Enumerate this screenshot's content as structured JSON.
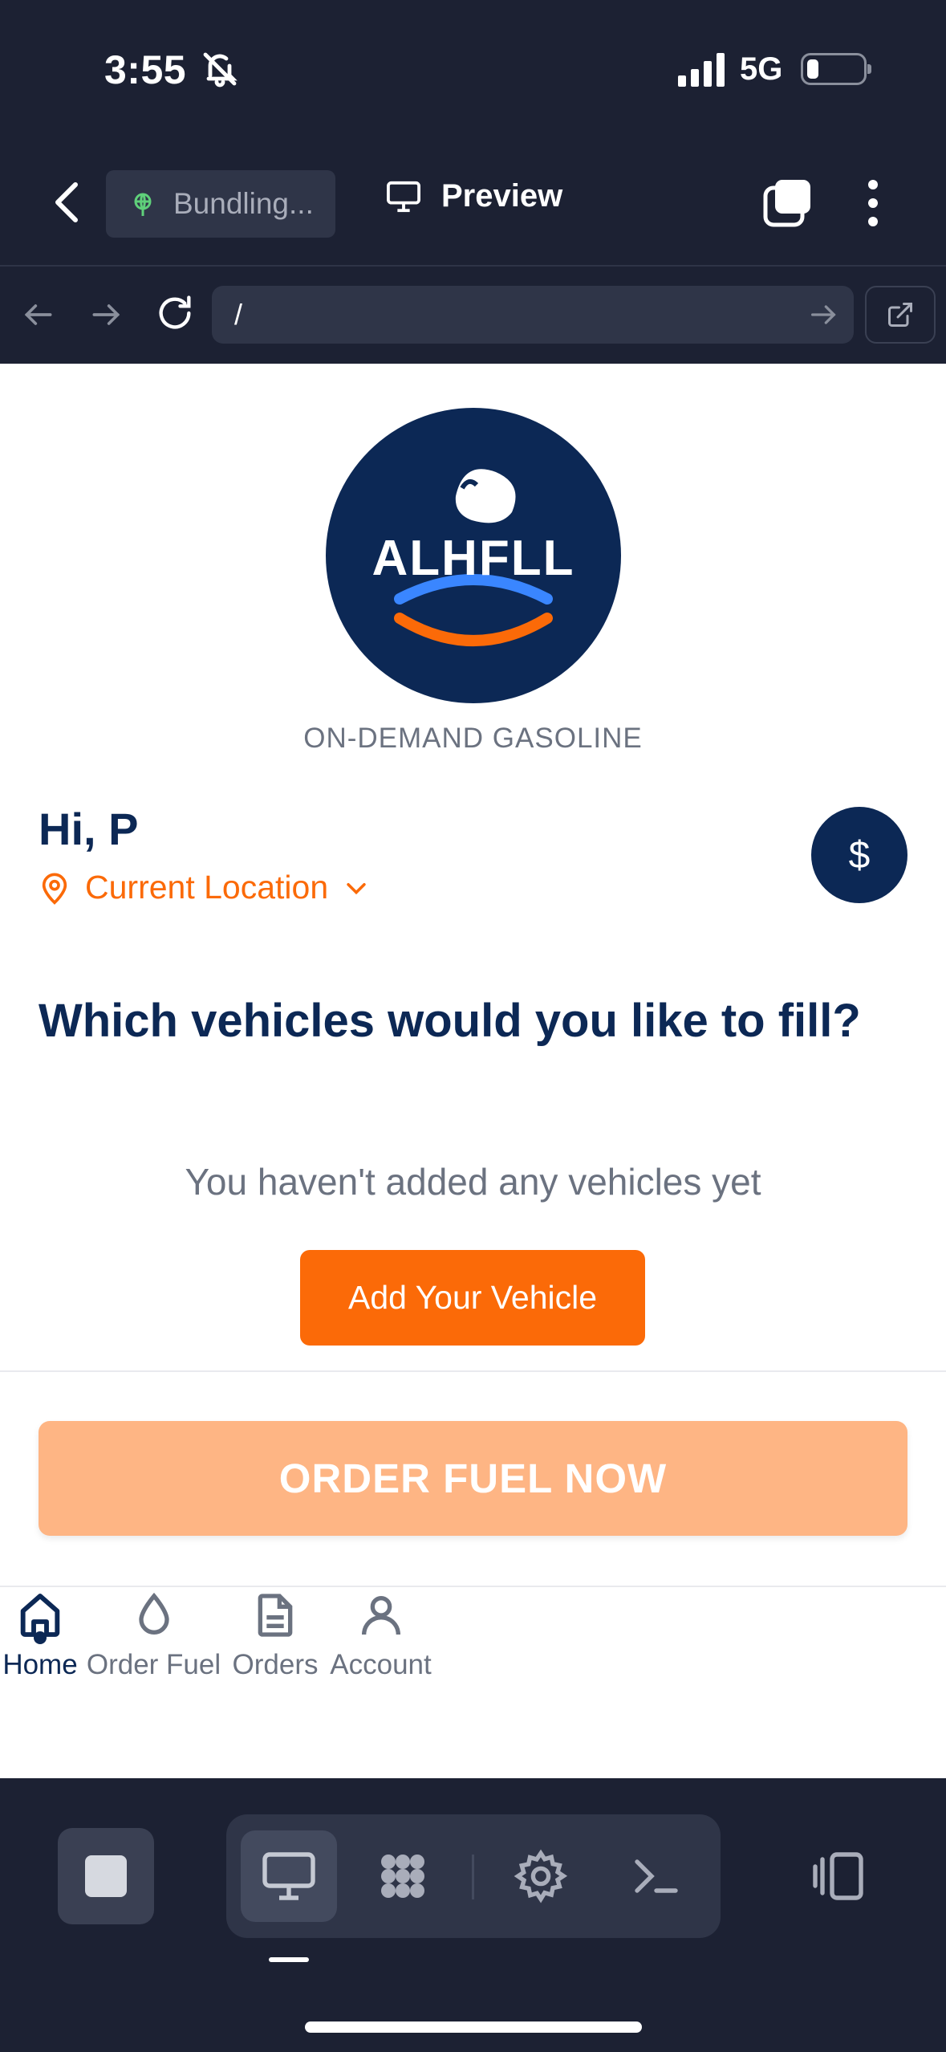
{
  "status_bar": {
    "time": "3:55",
    "network": "5G",
    "battery_level": 0.15
  },
  "app_bar": {
    "bundling_label": "Bundling...",
    "preview_label": "Preview"
  },
  "browser": {
    "url": "/"
  },
  "app": {
    "logo_text": "ALHFLL",
    "tagline": "ON-DEMAND GASOLINE",
    "greeting": "Hi, P",
    "location_label": "Current Location",
    "currency_symbol": "$",
    "question": "Which vehicles would you like to fill?",
    "empty_state": "You haven't added any vehicles yet",
    "add_vehicle_label": "Add Your Vehicle",
    "order_button_label": "ORDER FUEL NOW",
    "tabs": [
      {
        "label": "Home",
        "icon": "home-icon",
        "active": true
      },
      {
        "label": "Order Fuel",
        "icon": "droplet-icon",
        "active": false
      },
      {
        "label": "Orders",
        "icon": "document-icon",
        "active": false
      },
      {
        "label": "Account",
        "icon": "user-icon",
        "active": false
      }
    ]
  },
  "colors": {
    "navy": "#0c2855",
    "orange": "#fb6a08",
    "orange_disabled": "#feb584",
    "chrome": "#1c2133"
  }
}
